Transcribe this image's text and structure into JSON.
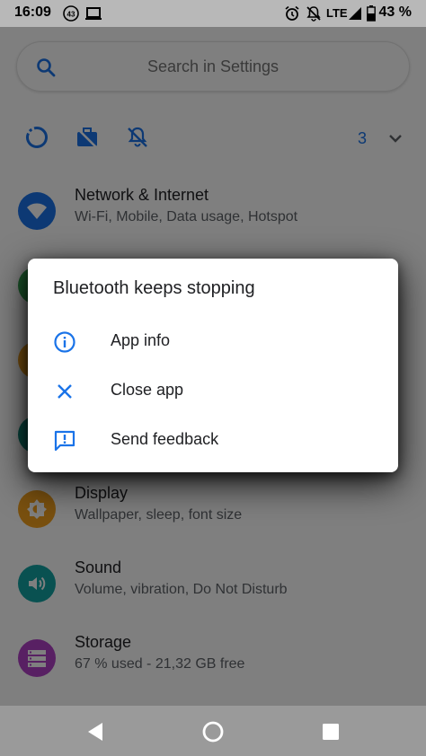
{
  "status_bar": {
    "time": "16:09",
    "notification_badge": "43",
    "network": "LTE",
    "battery": "43 %",
    "icons": [
      "notification-count-icon",
      "laptop-icon",
      "alarm-icon",
      "notifications-off-icon",
      "signal-icon",
      "battery-icon"
    ]
  },
  "search": {
    "placeholder": "Search in Settings",
    "icon": "search-icon"
  },
  "quick_settings": {
    "icons": [
      "data-saver-icon",
      "work-profile-icon",
      "do-not-disturb-icon"
    ],
    "count": "3",
    "expand_icon": "chevron-down-icon"
  },
  "settings_items": [
    {
      "title": "Network & Internet",
      "subtitle": "Wi-Fi, Mobile, Data usage, Hotspot",
      "icon": "wifi-icon",
      "color": "#1a73e8"
    },
    {
      "title": "Display",
      "subtitle": "Wallpaper, sleep, font size",
      "icon": "brightness-icon",
      "color": "#f2a01e"
    },
    {
      "title": "Sound",
      "subtitle": "Volume, vibration, Do Not Disturb",
      "icon": "volume-icon",
      "color": "#12a3a3"
    },
    {
      "title": "Storage",
      "subtitle": "67 % used - 21,32 GB free",
      "icon": "storage-icon",
      "color": "#b040c6"
    }
  ],
  "dialog": {
    "title": "Bluetooth keeps stopping",
    "options": [
      {
        "label": "App info",
        "icon": "info-icon"
      },
      {
        "label": "Close app",
        "icon": "close-icon"
      },
      {
        "label": "Send feedback",
        "icon": "feedback-icon"
      }
    ],
    "accent": "#1a73e8"
  },
  "nav_bar": {
    "buttons": [
      "back-icon",
      "home-icon",
      "recents-icon"
    ]
  }
}
